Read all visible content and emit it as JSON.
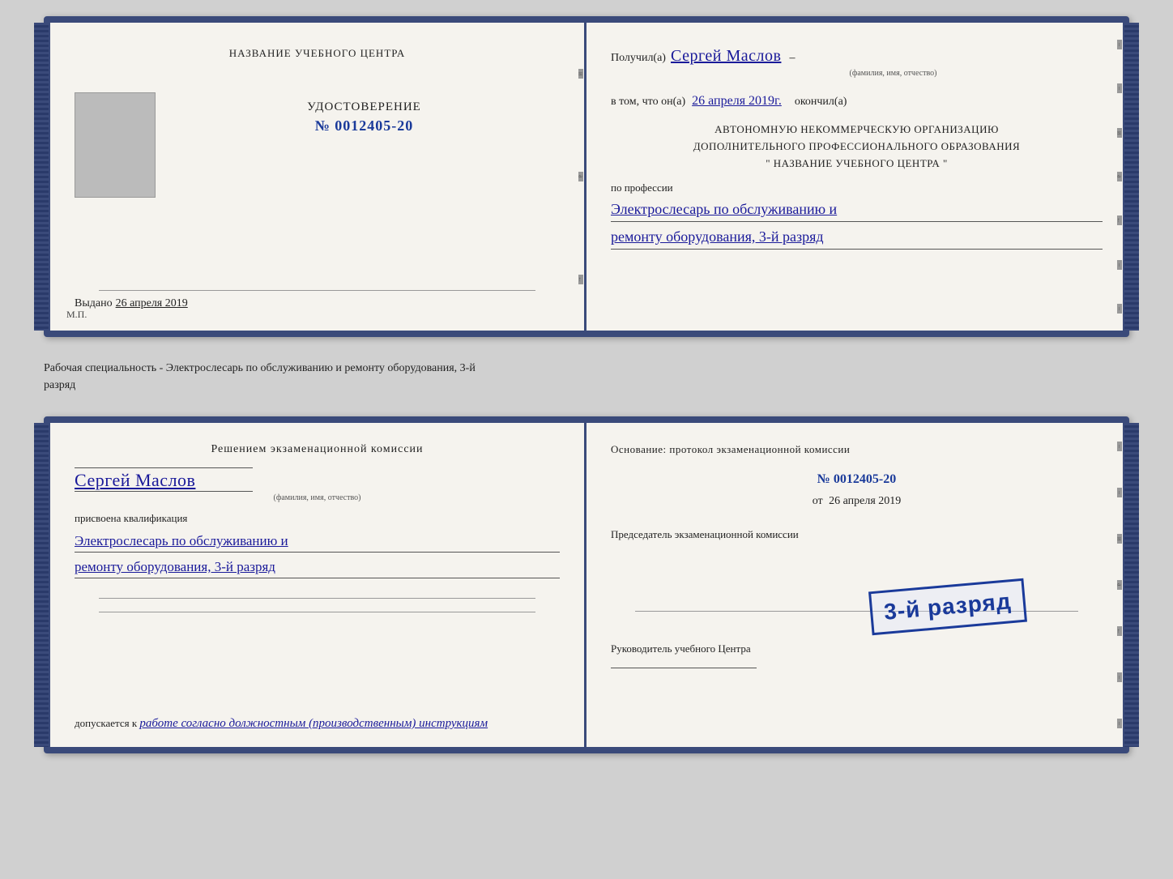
{
  "doc1": {
    "left": {
      "org_name": "НАЗВАНИЕ УЧЕБНОГО ЦЕНТРА",
      "udostoverenie_label": "УДОСТОВЕРЕНИЕ",
      "number": "№ 0012405-20",
      "vydano_label": "Выдано",
      "vydano_date": "26 апреля 2019",
      "mp_label": "М.П."
    },
    "right": {
      "poluchil_label": "Получил(а)",
      "recipient_name": "Сергей Маслов",
      "fio_subtitle": "(фамилия, имя, отчество)",
      "dash": "–",
      "vtom_label": "в том, что он(а)",
      "vtom_date": "26 апреля 2019г.",
      "okonchil_label": "окончил(а)",
      "org_block_line1": "АВТОНОМНУЮ НЕКОММЕРЧЕСКУЮ ОРГАНИЗАЦИЮ",
      "org_block_line2": "ДОПОЛНИТЕЛЬНОГО ПРОФЕССИОНАЛЬНОГО ОБРАЗОВАНИЯ",
      "org_block_line3": "\"    НАЗВАНИЕ УЧЕБНОГО ЦЕНТРА    \"",
      "po_professii_label": "по профессии",
      "profession_line1": "Электрослесарь по обслуживанию и",
      "profession_line2": "ремонту оборудования, 3-й разряд"
    }
  },
  "separator": {
    "text": "Рабочая специальность - Электрослесарь по обслуживанию и ремонту оборудования, 3-й",
    "text2": "разряд"
  },
  "doc2": {
    "left": {
      "resheniem_label": "Решением экзаменационной комиссии",
      "name": "Сергей Маслов",
      "fio_subtitle": "(фамилия, имя, отчество)",
      "prisvoena_label": "присвоена квалификация",
      "qualification_line1": "Электрослесарь по обслуживанию и",
      "qualification_line2": "ремонту оборудования, 3-й разряд",
      "dopuskaetsya_label": "допускается к",
      "dopuskaetsya_value": "работе согласно должностным (производственным) инструкциям"
    },
    "right": {
      "osnovanie_label": "Основание: протокол экзаменационной комиссии",
      "number": "№  0012405-20",
      "ot_label": "от",
      "ot_date": "26 апреля 2019",
      "predsedatel_label": "Председатель экзаменационной комиссии",
      "stamp_text": "3-й разряд",
      "rukovoditel_label": "Руководитель учебного Центра"
    }
  }
}
